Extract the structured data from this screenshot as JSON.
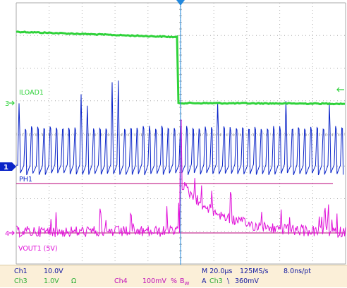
{
  "colors": {
    "ch1": "#0a24c8",
    "ch3": "#2fd23a",
    "ch4": "#e010d8",
    "ref": "#b8007a",
    "grid": "#a8a8a8",
    "trigger": "#2288dd",
    "statusbar": "#fbefd8",
    "status_text": "#1018a0"
  },
  "markers": {
    "ch3": "3",
    "ch1": "1",
    "ch4": "4"
  },
  "waveforms": {
    "iload": {
      "label": "ILOAD1"
    },
    "ph": {
      "label": "PH1"
    },
    "vout": {
      "label": "VOUT1 (5V)"
    }
  },
  "status": {
    "ch1_name": "Ch1",
    "ch1_scale": "10.0V",
    "ch3_name": "Ch3",
    "ch3_scale": "1.0V",
    "ch3_unit": "Ω",
    "ch4_name": "Ch4",
    "ch4_scale": "100mV",
    "ch4_mark": "%",
    "bw_label": "B",
    "bw_sub": "W",
    "timebase": "M 20.0µs",
    "sample_rate": "125MS/s",
    "resolution": "8.0ns/pt",
    "trigger_mode": "A",
    "trigger_source": "Ch3",
    "trigger_slope": "\\",
    "trigger_level": "360mV"
  }
}
